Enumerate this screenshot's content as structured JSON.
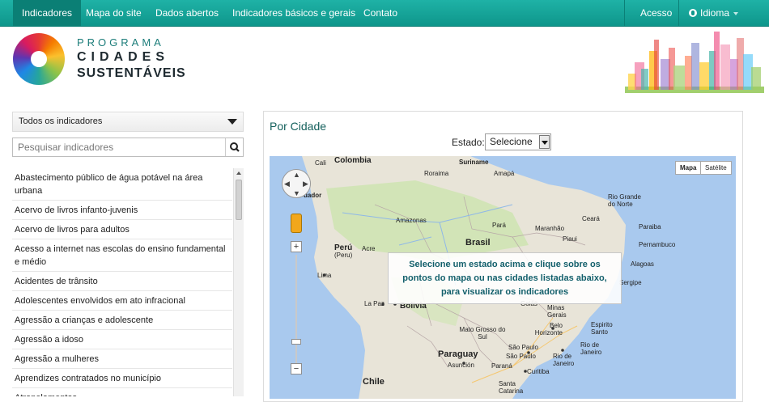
{
  "nav": {
    "items": [
      "Indicadores",
      "Mapa do site",
      "Dados abertos",
      "Indicadores básicos e gerais",
      "Contato"
    ],
    "right": {
      "acesso": "Acesso",
      "idioma": "Idioma"
    }
  },
  "logo": {
    "line1": "PROGRAMA",
    "line2": "CIDADES",
    "line3": "SUSTENTÁVEIS"
  },
  "sidebar": {
    "filter_label": "Todos os indicadores",
    "search_placeholder": "Pesquisar indicadores",
    "items": [
      "Abastecimento público de água potável na área urbana",
      "Acervo de livros infanto-juvenis",
      "Acervo de livros para adultos",
      "Acesso a internet nas escolas do ensino fundamental e médio",
      "Acidentes de trânsito",
      "Adolescentes envolvidos em ato infracional",
      "Agressão a crianças e adolescente",
      "Agressão a idoso",
      "Agressão a mulheres",
      "Aprendizes contratados no município",
      "Atropelamentos"
    ]
  },
  "main": {
    "title": "Por Cidade",
    "estado_label": "Estado:",
    "estado_value": "Selecione",
    "map": {
      "types": [
        "Mapa",
        "Satélite"
      ],
      "message": [
        "Selecione um estado acima e clique sobre os",
        "pontos do mapa ou nas cidades listadas abaixo,",
        "para visualizar os indicadores"
      ],
      "labels": {
        "cali": "Cali",
        "colombia": "Colombia",
        "suriname": "Suriname",
        "roraima": "Roraima",
        "amapa": "Amapá",
        "uador": "uador",
        "amazonas": "Amazonas",
        "para": "Pará",
        "maranhao": "Maranhão",
        "ceara": "Ceará",
        "rgn": "Rio Grande do Norte",
        "paraiba": "Paraiba",
        "pernambuco": "Pernambuco",
        "brasil": "Brasil",
        "piaui": "Piaui",
        "peru": "Perú",
        "peru2": "(Peru)",
        "acre": "Acre",
        "alagoas": "Alagoas",
        "sergipe": "Sergipe",
        "lima": "Lima",
        "lapaz": "La Paz",
        "bolivia": "Bolivia",
        "goias": "Goiás",
        "minas": "Minas Gerais",
        "espirito": "Espirito Santo",
        "belo": "Belo Horizonte",
        "matogrosso": "Mato Grosso do Sul",
        "riodejaneiro": "Rio de Janeiro",
        "saopaulo": "São Paulo",
        "saopaulo2": "São Paulo",
        "riodejaneiro2": "Rio de Janeiro",
        "paraguay": "Paraguay",
        "asuncion": "Asunción",
        "parana": "Paraná",
        "curitiba": "Curitiba",
        "santacatarina": "Santa Catarina",
        "chile": "Chile"
      }
    }
  }
}
